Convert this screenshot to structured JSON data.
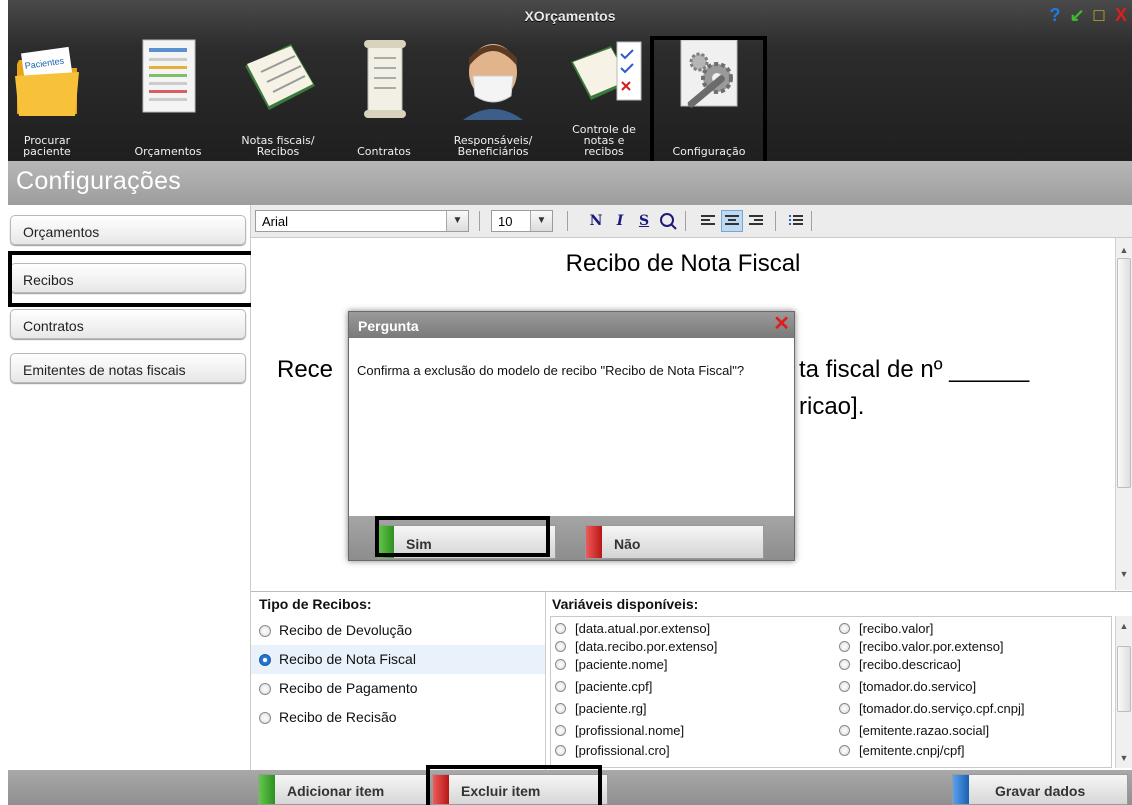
{
  "app": {
    "title": "XOrçamentos",
    "window_controls": [
      "?",
      "↙",
      "□",
      "X"
    ]
  },
  "toolbar": [
    {
      "label": "Procurar\npaciente",
      "icon": "folder-pacientes-icon",
      "folder_tab": "Pacientes"
    },
    {
      "label": "Orçamentos",
      "icon": "budget-document-icon"
    },
    {
      "label": "Notas fiscais/\nRecibos",
      "icon": "receipt-book-icon"
    },
    {
      "label": "Contratos",
      "icon": "contract-scroll-icon"
    },
    {
      "label": "Responsáveis/\nBeneficiários",
      "icon": "masked-person-icon"
    },
    {
      "label": "Controle de\nnotas e\nrecibos",
      "icon": "checklist-icon"
    },
    {
      "label": "Configuração",
      "icon": "gears-wrench-icon"
    }
  ],
  "section": {
    "title": "Configurações"
  },
  "sidebar": {
    "items": [
      {
        "label": "Orçamentos"
      },
      {
        "label": "Recibos"
      },
      {
        "label": "Contratos"
      },
      {
        "label": "Emitentes de notas fiscais"
      }
    ],
    "selected": "Recibos"
  },
  "editor": {
    "font": "Arial",
    "size": "10",
    "format_buttons": [
      "N",
      "I",
      "S"
    ],
    "document": {
      "title": "Recibo de Nota Fiscal",
      "line1_left": "Rece",
      "line1_right": "ta fiscal de nº ______",
      "line2_right": "ricao]."
    }
  },
  "recibos": {
    "heading": "Tipo de Recibos:",
    "items": [
      {
        "label": "Recibo de Devolução",
        "selected": false
      },
      {
        "label": "Recibo de Nota Fiscal",
        "selected": true
      },
      {
        "label": "Recibo de Pagamento",
        "selected": false
      },
      {
        "label": "Recibo de Recisão",
        "selected": false
      }
    ]
  },
  "variables": {
    "heading": "Variáveis disponíveis:",
    "col1": [
      "[data.atual.por.extenso]",
      "[data.recibo.por.extenso]",
      "[paciente.nome]",
      "[paciente.cpf]",
      "[paciente.rg]",
      "[profissional.nome]",
      "[profissional.cro]"
    ],
    "col2": [
      "[recibo.valor]",
      "[recibo.valor.por.extenso]",
      "[recibo.descricao]",
      "[tomador.do.servico]",
      "[tomador.do.serviço.cpf.cnpj]",
      "[emitente.razao.social]",
      "[emitente.cnpj/cpf]"
    ]
  },
  "bottom": {
    "add": "Adicionar item",
    "delete": "Excluir item",
    "save": "Gravar dados"
  },
  "dialog": {
    "title": "Pergunta",
    "message": "Confirma a exclusão do modelo de recibo \"Recibo de Nota Fiscal\"?",
    "yes": "Sim",
    "no": "Não"
  },
  "colors": {
    "green": "#3aa52a",
    "red": "#d01e1e",
    "blue": "#2a6fc9",
    "accent_help": "#1e7be0",
    "accent_min": "#3cbf2a",
    "accent_max": "#e0b21a"
  }
}
